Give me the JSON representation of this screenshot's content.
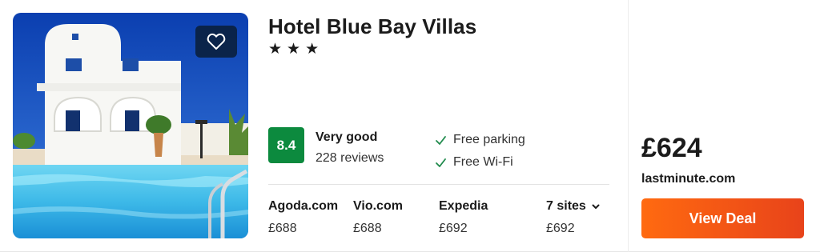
{
  "hotel": {
    "name": "Hotel Blue Bay Villas",
    "stars": [
      "★",
      "★",
      "★"
    ],
    "score": "8.4",
    "rating_label": "Very good",
    "reviews": "228 reviews",
    "amenities": [
      "Free parking",
      "Free Wi-Fi"
    ]
  },
  "providers": [
    {
      "name": "Agoda.com",
      "price": "£688"
    },
    {
      "name": "Vio.com",
      "price": "£688"
    },
    {
      "name": "Expedia",
      "price": "£692"
    },
    {
      "name": "7 sites",
      "price": "£692"
    }
  ],
  "deal": {
    "price": "£624",
    "site": "lastminute.com",
    "button_label": "View Deal"
  },
  "colors": {
    "score_badge": "#0c8a3e",
    "deal_button": "#ff6a10",
    "check": "#1f8a4c"
  },
  "icons": {
    "favorite": "heart-outline-icon",
    "amenity": "check-icon",
    "more_sites": "chevron-down-icon"
  }
}
